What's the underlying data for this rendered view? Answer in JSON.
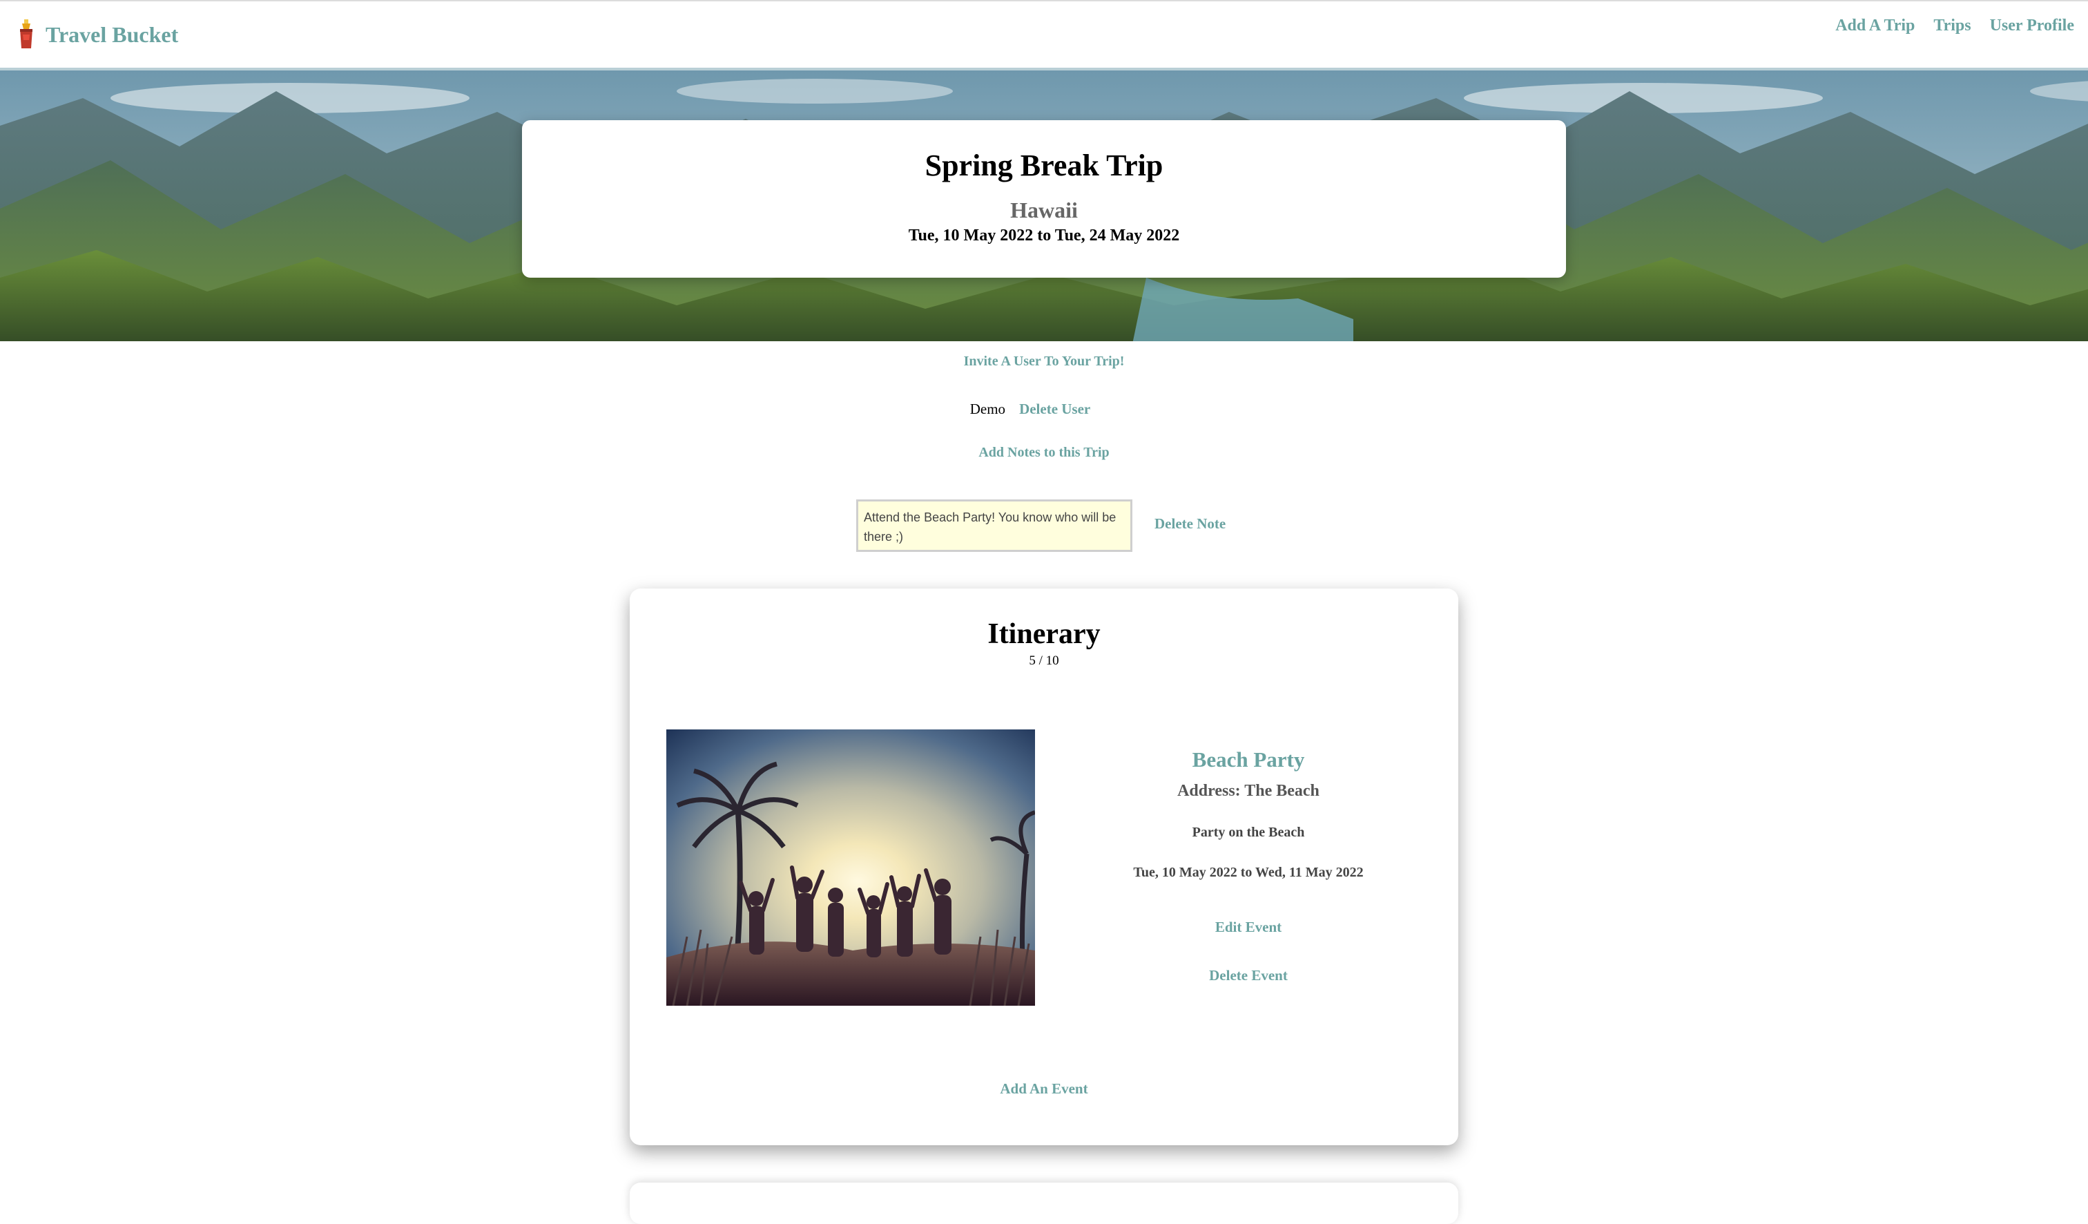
{
  "app": {
    "name": "Travel Bucket",
    "nav": [
      "Add A Trip",
      "Trips",
      "User Profile"
    ]
  },
  "trip": {
    "title": "Spring Break Trip",
    "location": "Hawaii",
    "dates": "Tue, 10 May 2022 to Tue, 24 May 2022"
  },
  "actions": {
    "invite": "Invite A User To Your Trip!",
    "add_notes": "Add Notes to this Trip"
  },
  "members": [
    {
      "name": "Demo",
      "delete_label": "Delete User"
    }
  ],
  "notes": [
    {
      "text": "Attend the Beach Party! You know who will be there ;)",
      "delete_label": "Delete Note"
    }
  ],
  "itinerary": {
    "title": "Itinerary",
    "count": "5 / 10",
    "event": {
      "name": "Beach Party",
      "address": "Address: The Beach",
      "description": "Party on the Beach",
      "dates": "Tue, 10 May 2022 to Wed, 11 May 2022",
      "edit_label": "Edit Event",
      "delete_label": "Delete Event"
    },
    "add_event_label": "Add An Event"
  },
  "colors": {
    "accent": "#6aa3a1",
    "note_bg": "#fffedd"
  }
}
